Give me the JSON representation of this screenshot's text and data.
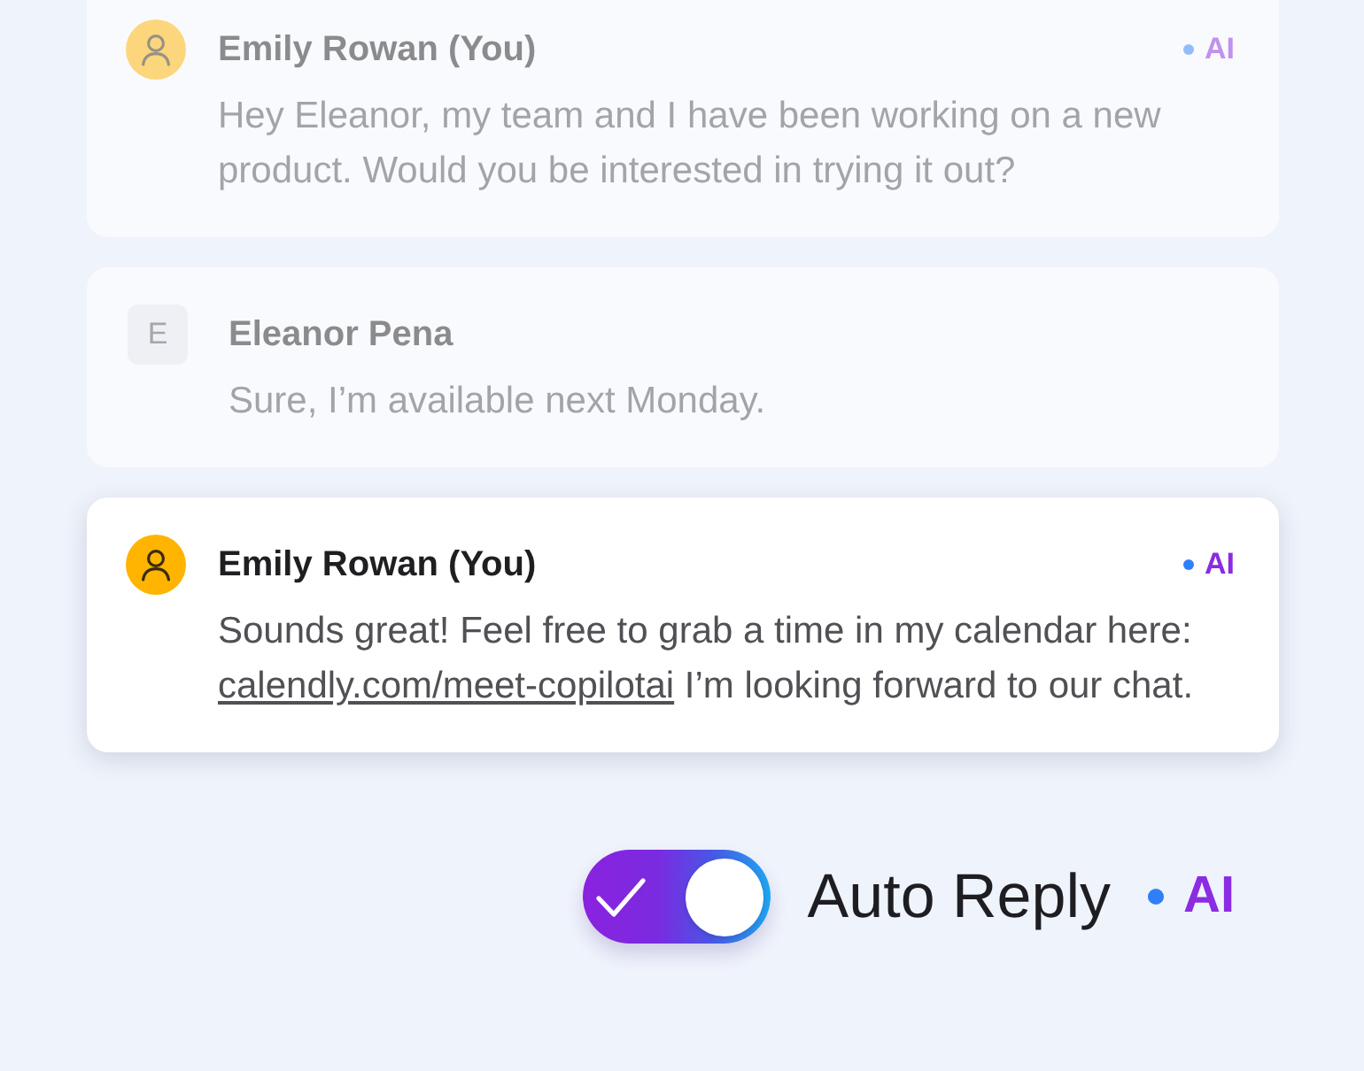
{
  "messages": [
    {
      "sender": "Emily Rowan (You)",
      "avatar": {
        "kind": "icon"
      },
      "highlighted": false,
      "badge": "AI",
      "text": "Hey Eleanor, my team and I have been working on a new product. Would you be interested in trying it out?"
    },
    {
      "sender": "Eleanor Pena",
      "avatar": {
        "kind": "initial",
        "letter": "E"
      },
      "highlighted": false,
      "text": "Sure, I’m available next Monday."
    },
    {
      "sender": "Emily Rowan (You)",
      "avatar": {
        "kind": "icon"
      },
      "highlighted": true,
      "badge": "AI",
      "text": "Sounds great! Feel free to grab a time in my calendar here:",
      "link": "calendly.com/meet-copilotai",
      "text_after_link": "I’m looking forward to our chat."
    }
  ],
  "auto_reply": {
    "label": "Auto Reply",
    "on": true,
    "badge": "AI"
  }
}
